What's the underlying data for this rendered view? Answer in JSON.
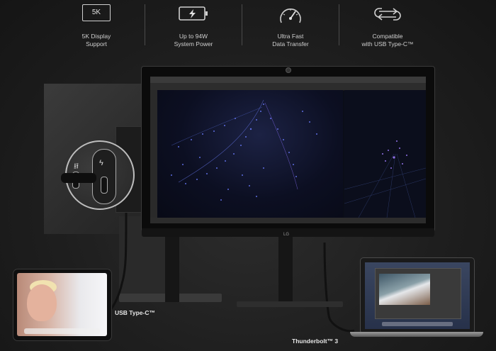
{
  "features": [
    {
      "icon": "5k-display-icon",
      "icon_text": "5K",
      "label_line1": "5K Display",
      "label_line2": "Support"
    },
    {
      "icon": "battery-charge-icon",
      "label_line1": "Up to 94W",
      "label_line2": "System Power"
    },
    {
      "icon": "speedometer-icon",
      "label_line1": "Ultra Fast",
      "label_line2": "Data Transfer"
    },
    {
      "icon": "sync-arrows-icon",
      "label_line1": "Compatible",
      "label_line2": "with USB Type-C™"
    }
  ],
  "cables": {
    "usb_c_label": "USB Type-C™",
    "thunderbolt_label": "Thunderbolt™ 3"
  },
  "monitor": {
    "brand": "LG"
  },
  "colors": {
    "background": "#1b1b1b",
    "particles": "#6b7cff",
    "text": "#cfcfcf"
  }
}
